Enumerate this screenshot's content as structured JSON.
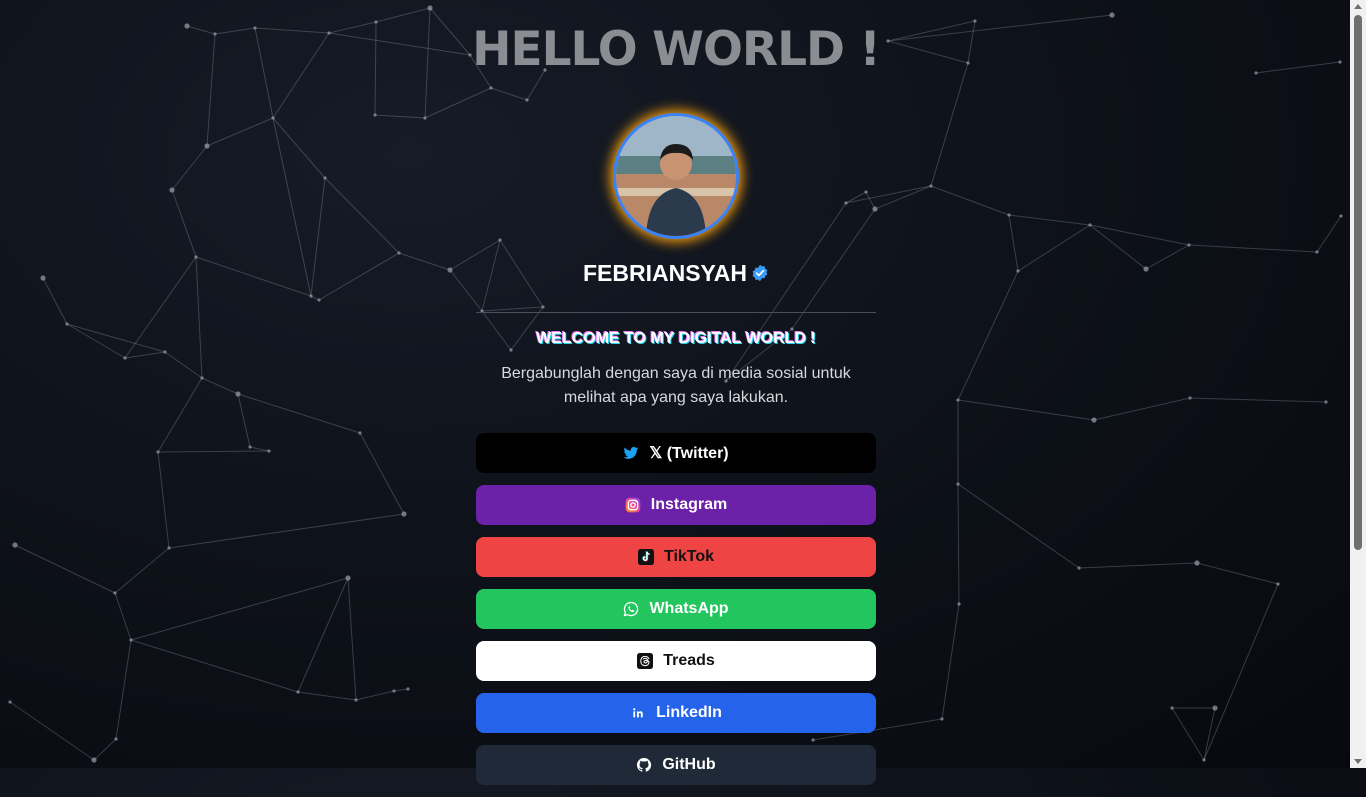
{
  "header": {
    "title": "HELLO WORLD !"
  },
  "profile": {
    "name": "FEBRIANSYAH",
    "avatar_alt": "profile photo",
    "verified_icon": "verified-badge-icon"
  },
  "intro": {
    "welcome": "WELCOME TO MY DIGITAL WORLD !",
    "description": "Bergabunglah dengan saya di media sosial untuk melihat apa yang saya lakukan."
  },
  "links": [
    {
      "label": "𝕏 (Twitter)",
      "icon": "twitter-icon",
      "bg": "#000000",
      "fg": "#ffffff"
    },
    {
      "label": "Instagram",
      "icon": "instagram-icon",
      "bg": "#6b21a8",
      "fg": "#ffffff"
    },
    {
      "label": "TikTok",
      "icon": "tiktok-icon",
      "bg": "#ef4444",
      "fg": "#111111"
    },
    {
      "label": "WhatsApp",
      "icon": "whatsapp-icon",
      "bg": "#22c55e",
      "fg": "#ffffff"
    },
    {
      "label": "Treads",
      "icon": "threads-icon",
      "bg": "#ffffff",
      "fg": "#111111"
    },
    {
      "label": "LinkedIn",
      "icon": "linkedin-icon",
      "bg": "#2563eb",
      "fg": "#ffffff"
    },
    {
      "label": "GitHub",
      "icon": "github-icon",
      "bg": "#1f2937",
      "fg": "#ffffff"
    }
  ],
  "colors": {
    "avatar_ring": "#3b82f6",
    "avatar_glow": "#f59e0b"
  }
}
